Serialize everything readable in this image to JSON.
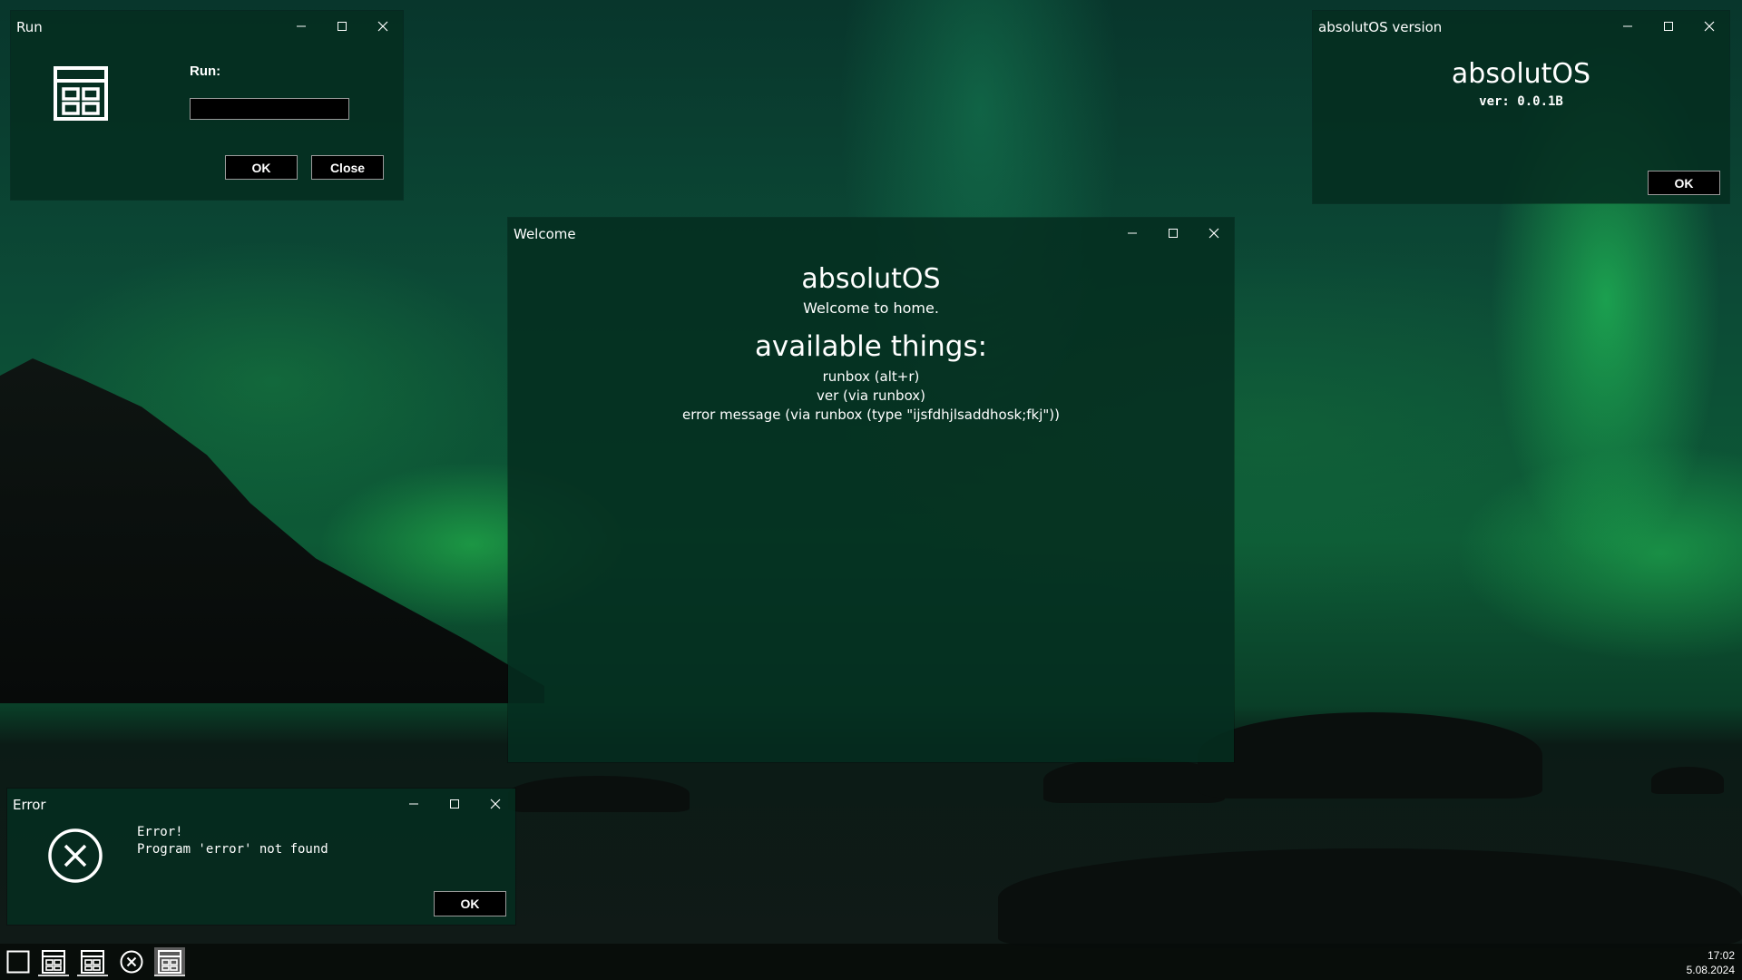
{
  "run_window": {
    "title": "Run",
    "label": "Run:",
    "input_value": "",
    "ok_label": "OK",
    "close_label": "Close",
    "icon": "window-layout-icon"
  },
  "version_window": {
    "title": "absolutOS version",
    "heading": "absolutOS",
    "version": "ver: 0.0.1B",
    "ok_label": "OK"
  },
  "welcome_window": {
    "title": "Welcome",
    "heading": "absolutOS",
    "subheading": "Welcome to home.",
    "section_title": "available things:",
    "items": [
      "runbox (alt+r)",
      "ver (via runbox)",
      "error message (via runbox (type \"ijsfdhjlsaddhosk;fkj\"))"
    ]
  },
  "error_window": {
    "title": "Error",
    "heading": "Error!",
    "message": "Program 'error' not found",
    "ok_label": "OK",
    "icon": "error-circle-x-icon"
  },
  "taskbar": {
    "clock_time": "17:02",
    "clock_date": "5.08.2024",
    "items": [
      {
        "icon": "start-square-icon",
        "active": false,
        "open": false
      },
      {
        "icon": "window-layout-icon",
        "active": false,
        "open": true
      },
      {
        "icon": "window-layout-icon",
        "active": false,
        "open": true
      },
      {
        "icon": "error-circle-x-icon",
        "active": false,
        "open": false
      },
      {
        "icon": "window-layout-icon",
        "active": true,
        "open": true
      }
    ]
  },
  "colors": {
    "window_bg": "#052d20",
    "button_bg": "#000000",
    "taskbar_bg": "#080c0a",
    "text": "#ffffff"
  }
}
